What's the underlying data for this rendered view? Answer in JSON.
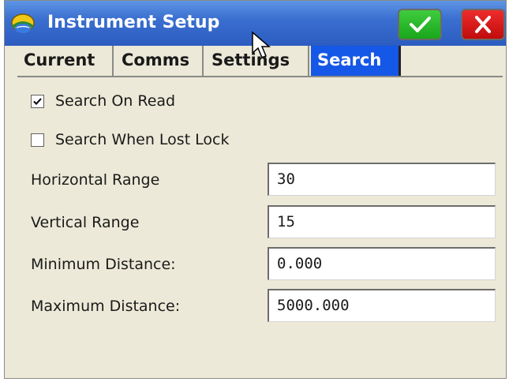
{
  "window": {
    "title": "Instrument Setup",
    "icons": {
      "app": "helmet-globe-icon",
      "ok": "checkmark-icon",
      "cancel": "close-icon"
    }
  },
  "tabs": [
    {
      "label": "Current",
      "active": false
    },
    {
      "label": "Comms",
      "active": false
    },
    {
      "label": "Settings",
      "active": false
    },
    {
      "label": "Search",
      "active": true
    }
  ],
  "search": {
    "search_on_read": {
      "label": "Search On Read",
      "checked": true
    },
    "search_when_lost_lock": {
      "label": "Search When Lost Lock",
      "checked": false
    },
    "fields": [
      {
        "label": "Horizontal Range",
        "value": "30"
      },
      {
        "label": "Vertical Range",
        "value": "15"
      },
      {
        "label": "Minimum Distance:",
        "value": "0.000"
      },
      {
        "label": "Maximum Distance:",
        "value": "5000.000"
      }
    ]
  },
  "colors": {
    "titlebar": "#2c5cc0",
    "active_tab": "#1557e6",
    "ok_button": "#1aa61a",
    "cancel_button": "#c10c0c",
    "panel_bg": "#ece9d8"
  }
}
